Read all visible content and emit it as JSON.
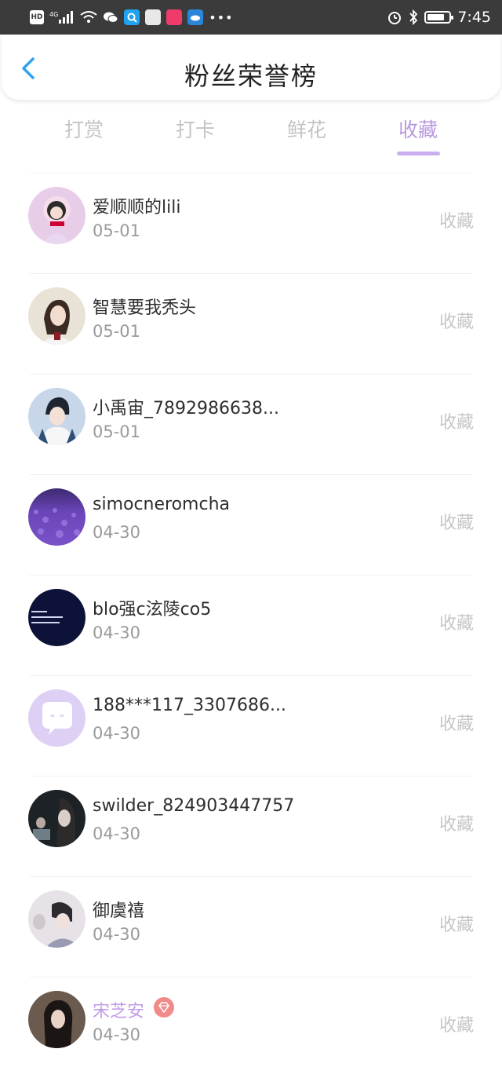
{
  "status_bar": {
    "hd": "HD",
    "signal": "4G",
    "time": "7:45",
    "battery_level": 0.8
  },
  "header": {
    "title": "粉丝荣誉榜"
  },
  "tabs": [
    {
      "label": "打赏",
      "active": false
    },
    {
      "label": "打卡",
      "active": false
    },
    {
      "label": "鲜花",
      "active": false
    },
    {
      "label": "收藏",
      "active": true
    }
  ],
  "list": [
    {
      "name": "爱顺顺的lili",
      "date": "05-01",
      "action": "收藏"
    },
    {
      "name": "智慧要我秃头",
      "date": "05-01",
      "action": "收藏"
    },
    {
      "name": "小禹宙_7892986638...",
      "date": "05-01",
      "action": "收藏"
    },
    {
      "name": "simocneromcha",
      "date": "04-30",
      "action": "收藏"
    },
    {
      "name": "blo强c泫陵co5",
      "date": "04-30",
      "action": "收藏"
    },
    {
      "name": "188***117_3307686...",
      "date": "04-30",
      "action": "收藏"
    },
    {
      "name": "swilder_824903447757",
      "date": "04-30",
      "action": "收藏"
    },
    {
      "name": "御虞禧",
      "date": "04-30",
      "action": "收藏"
    },
    {
      "name": "宋芝安",
      "date": "04-30",
      "action": "收藏",
      "vip": true
    }
  ],
  "colors": {
    "accent": "#b89ae0",
    "vip_name": "#c39be8",
    "back_arrow": "#2ea3f2",
    "inactive_tab": "#c4c4c4"
  }
}
